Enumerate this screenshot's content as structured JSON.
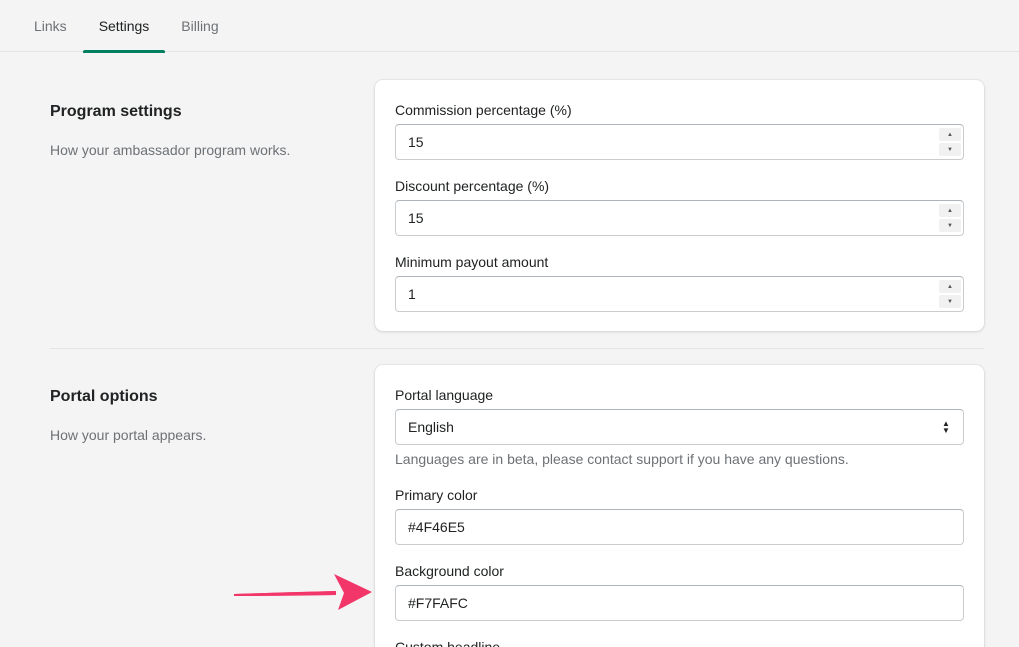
{
  "tabs": [
    {
      "label": "Links"
    },
    {
      "label": "Settings"
    },
    {
      "label": "Billing"
    }
  ],
  "program": {
    "title": "Program settings",
    "description": "How your ambassador program works.",
    "commission": {
      "label": "Commission percentage (%)",
      "value": "15"
    },
    "discount": {
      "label": "Discount percentage (%)",
      "value": "15"
    },
    "min_payout": {
      "label": "Minimum payout amount",
      "value": "1"
    }
  },
  "portal": {
    "title": "Portal options",
    "description": "How your portal appears.",
    "language": {
      "label": "Portal language",
      "value": "English",
      "help": "Languages are in beta, please contact support if you have any questions."
    },
    "primary_color": {
      "label": "Primary color",
      "value": "#4F46E5"
    },
    "background_color": {
      "label": "Background color",
      "value": "#F7FAFC"
    },
    "custom_headline": {
      "label": "Custom headline"
    }
  },
  "colors": {
    "accent": "#008060",
    "annotation_arrow": "#F2366A"
  }
}
